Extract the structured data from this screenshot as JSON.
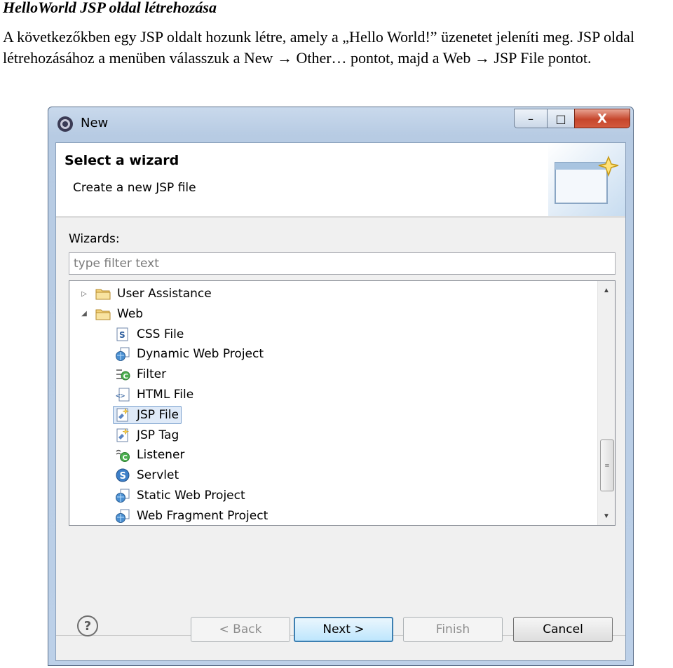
{
  "document": {
    "title": "HelloWorld JSP oldal létrehozása",
    "paragraph": "A következőkben egy JSP oldalt hozunk létre, amely a „Hello World!” üzenetet jeleníti meg. JSP oldal létrehozásához a menüben válasszuk a New → Other… pontot, majd a Web → JSP File pontot."
  },
  "dialog": {
    "title": "New",
    "controls": {
      "minimize": "–",
      "maximize": "□",
      "close": "X"
    },
    "banner": {
      "title": "Select a wizard",
      "description": "Create a new JSP file"
    },
    "wizards_label": "Wizards:",
    "filter_placeholder": "type filter text",
    "tree": [
      {
        "label": "User Assistance",
        "level": 0,
        "expanded": false,
        "icon": "folder-icon"
      },
      {
        "label": "Web",
        "level": 0,
        "expanded": true,
        "icon": "folder-icon"
      },
      {
        "label": "CSS File",
        "level": 1,
        "icon": "css-file-icon"
      },
      {
        "label": "Dynamic Web Project",
        "level": 1,
        "icon": "web-project-icon"
      },
      {
        "label": "Filter",
        "level": 1,
        "icon": "filter-icon"
      },
      {
        "label": "HTML File",
        "level": 1,
        "icon": "html-file-icon"
      },
      {
        "label": "JSP File",
        "level": 1,
        "icon": "jsp-file-icon",
        "selected": true
      },
      {
        "label": "JSP Tag",
        "level": 1,
        "icon": "jsp-tag-icon"
      },
      {
        "label": "Listener",
        "level": 1,
        "icon": "listener-icon"
      },
      {
        "label": "Servlet",
        "level": 1,
        "icon": "servlet-icon"
      },
      {
        "label": "Static Web Project",
        "level": 1,
        "icon": "web-project-icon"
      },
      {
        "label": "Web Fragment Project",
        "level": 1,
        "icon": "web-project-icon"
      }
    ],
    "buttons": {
      "help": "?",
      "back": "< Back",
      "next": "Next >",
      "finish": "Finish",
      "cancel": "Cancel"
    }
  },
  "colors": {
    "selection": "#dfeaf8",
    "title_bar": "#c9d9ec",
    "close_button": "#c6462c"
  }
}
